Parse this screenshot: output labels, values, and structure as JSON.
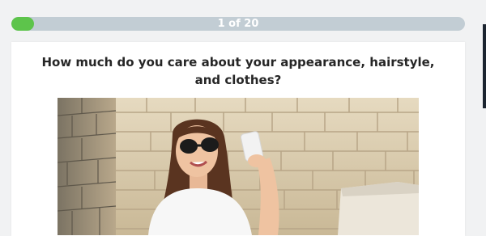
{
  "progress": {
    "label": "1 of 20",
    "current": 1,
    "total": 20,
    "fill_fraction": 0.05,
    "fill_color": "#5dc44b",
    "track_color": "#c2cdd4"
  },
  "question": {
    "text": "How much do you care about your appearance, hairstyle, and clothes?"
  },
  "image": {
    "icon": "photo-woman-selfie"
  }
}
